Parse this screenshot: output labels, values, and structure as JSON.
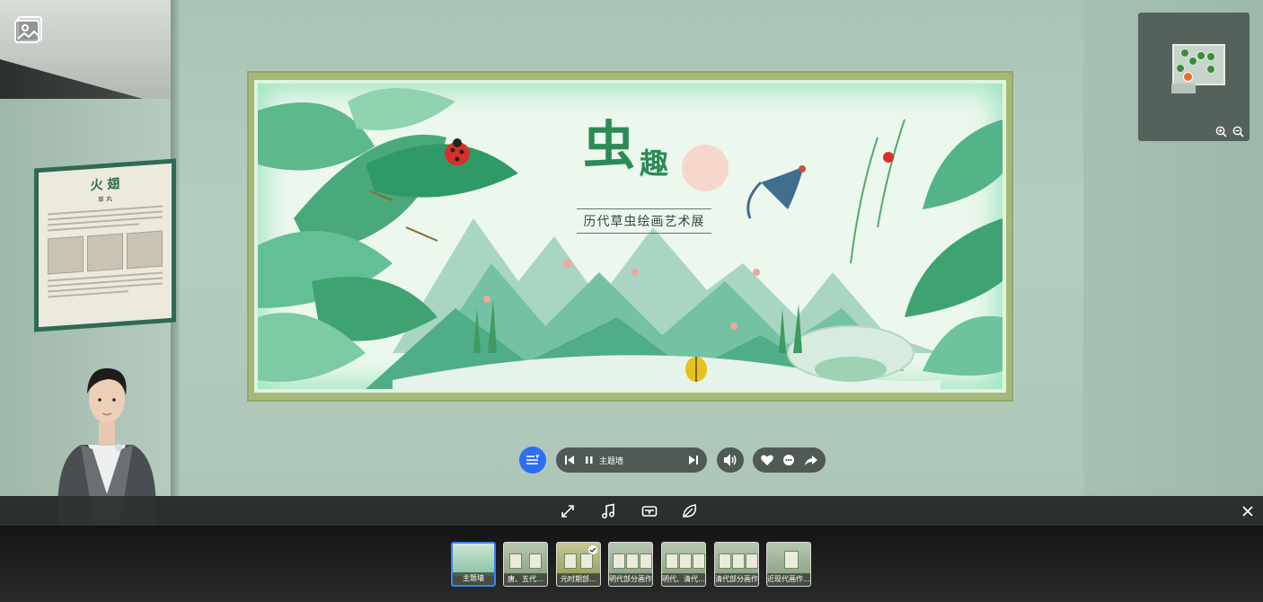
{
  "exhibition": {
    "title_char_1": "虫",
    "title_char_2": "趣",
    "subtitle": "历代草虫绘画艺术展"
  },
  "left_poster": {
    "title": "火 翅",
    "subtitle": "草 丸"
  },
  "player": {
    "current_track": "主题墙"
  },
  "thumbnails": [
    {
      "label": "主题墙",
      "active": true,
      "checked": false
    },
    {
      "label": "唐、五代…",
      "active": false,
      "checked": false
    },
    {
      "label": "元时期部…",
      "active": false,
      "checked": true
    },
    {
      "label": "明代部分画作",
      "active": false,
      "checked": false
    },
    {
      "label": "明代、清代…",
      "active": false,
      "checked": false
    },
    {
      "label": "清代部分画作",
      "active": false,
      "checked": false
    },
    {
      "label": "近现代画作…",
      "active": false,
      "checked": false
    }
  ],
  "icons": {
    "gallery": "gallery-icon",
    "list": "playlist-icon",
    "prev": "skip-previous-icon",
    "pause": "pause-icon",
    "next": "skip-next-icon",
    "volume": "volume-icon",
    "like": "heart-icon",
    "comment": "comment-icon",
    "share": "share-icon",
    "fullscreen": "expand-icon",
    "music": "music-note-icon",
    "vr": "vr-headset-icon",
    "scene": "leaf-icon",
    "close": "close-icon",
    "zoom_in": "zoom-in-icon",
    "zoom_out": "zoom-out-icon"
  },
  "colors": {
    "accent": "#2c6ff2",
    "title_green": "#2c8a55",
    "minimap_marker": "#f06a2a"
  }
}
